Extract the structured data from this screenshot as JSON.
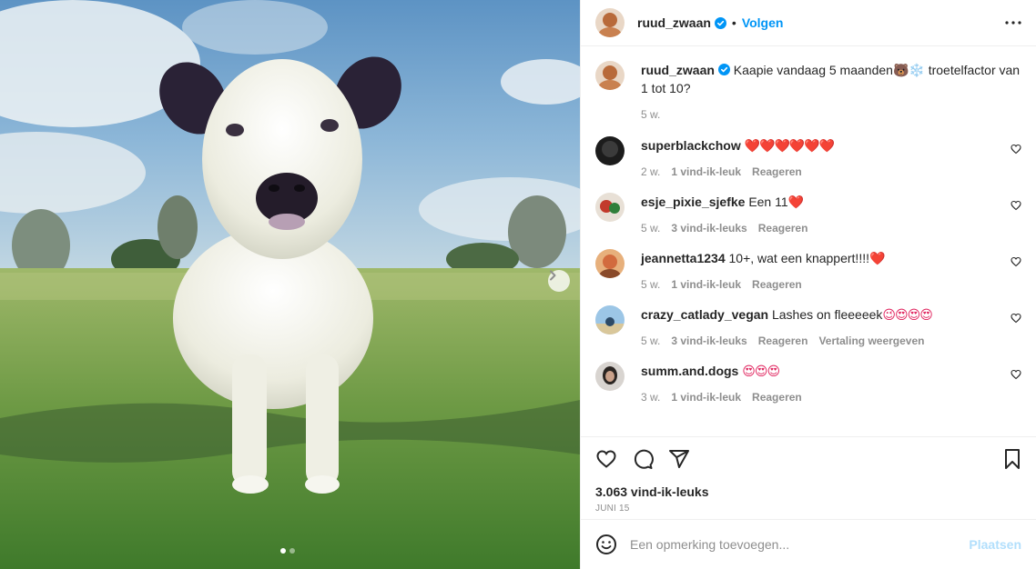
{
  "post": {
    "author": "ruud_zwaan",
    "follow_label": "Volgen",
    "separator": "•",
    "caption": "Kaapie vandaag 5 maanden🐻❄️ troetelfactor van 1 tot 10?",
    "caption_time": "5 w.",
    "likes": "3.063 vind-ik-leuks",
    "date": "JUNI 15",
    "image_alt": "Witte kalf in het gras",
    "carousel": {
      "total": 2,
      "current": 1
    }
  },
  "comments": [
    {
      "user": "superblackchow",
      "text": "",
      "emoji": "❤️❤️❤️❤️❤️❤️",
      "time": "2 w.",
      "likes": "1 vind-ik-leuk",
      "reply": "Reageren",
      "translate": ""
    },
    {
      "user": "esje_pixie_sjefke",
      "text": "Een 11",
      "emoji": "❤️",
      "time": "5 w.",
      "likes": "3 vind-ik-leuks",
      "reply": "Reageren",
      "translate": ""
    },
    {
      "user": "jeannetta1234",
      "text": "10+, wat een knappert!!!!",
      "emoji": "❤️",
      "time": "5 w.",
      "likes": "1 vind-ik-leuk",
      "reply": "Reageren",
      "translate": ""
    },
    {
      "user": "crazy_catlady_vegan",
      "text": "Lashes on fleeeeek",
      "emoji": "😉😍😍😍",
      "time": "5 w.",
      "likes": "3 vind-ik-leuks",
      "reply": "Reageren",
      "translate": "Vertaling weergeven"
    },
    {
      "user": "summ.and.dogs",
      "text": "",
      "emoji": "😍😍😍",
      "time": "3 w.",
      "likes": "1 vind-ik-leuk",
      "reply": "Reageren",
      "translate": ""
    }
  ],
  "add_comment": {
    "placeholder": "Een opmerking toevoegen...",
    "post_label": "Plaatsen"
  },
  "colors": {
    "link": "#0095f6",
    "muted": "#8e8e8e",
    "text": "#262626",
    "verified": "#0095f6",
    "post_disabled": "#b2dffc"
  },
  "icons": [
    "verified-badge-icon",
    "more-options-icon",
    "heart-icon",
    "comment-icon",
    "share-icon",
    "bookmark-icon",
    "emoji-icon",
    "chevron-right-icon"
  ]
}
